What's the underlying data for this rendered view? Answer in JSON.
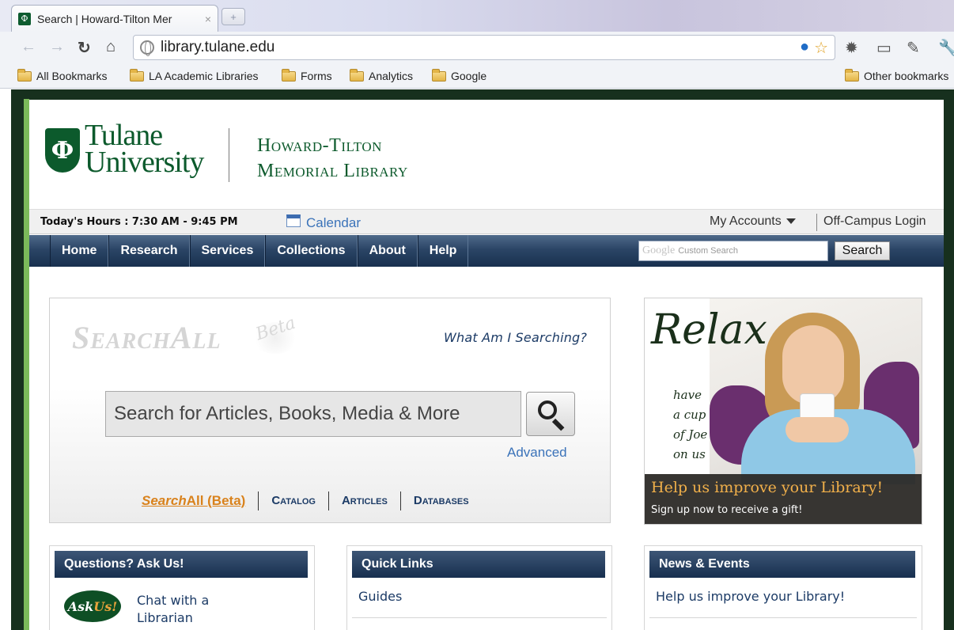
{
  "browser": {
    "tab_title": "Search | Howard-Tilton Mer",
    "url": "library.tulane.edu",
    "bookmarks": [
      "All Bookmarks",
      "LA Academic Libraries",
      "Forms",
      "Analytics",
      "Google"
    ],
    "other_bookmarks": "Other bookmarks"
  },
  "header": {
    "university_line1": "Tulane",
    "university_line2": "University",
    "library_line1": "Howard-Tilton",
    "library_line2": "Memorial Library"
  },
  "infobar": {
    "hours": "Today's Hours : 7:30 AM - 9:45 PM",
    "calendar": "Calendar",
    "my_accounts": "My Accounts",
    "off_campus": "Off-Campus Login"
  },
  "nav": {
    "items": [
      "Home",
      "Research",
      "Services",
      "Collections",
      "About",
      "Help"
    ],
    "search_brand": "Google",
    "search_placeholder": "Custom Search",
    "search_button": "Search"
  },
  "searchall": {
    "logo": "SearchAll",
    "beta": "Beta",
    "what_searching": "What Am I Searching?",
    "input_placeholder": "Search for Articles, Books, Media & More",
    "advanced": "Advanced",
    "tab_first_em": "Search",
    "tab_first_rest": "All (Beta)",
    "tabs": [
      "Catalog",
      "Articles",
      "Databases"
    ]
  },
  "promo": {
    "title": "Relax",
    "sub1": "have",
    "sub2": "a cup",
    "sub3": "of Joe",
    "sub4": "on us",
    "headline": "Help us improve your Library!",
    "subline": "Sign up now to receive a gift!"
  },
  "panels": {
    "questions_title": "Questions? Ask Us!",
    "askus_logo": "Ask",
    "askus_logo_us": "Us!",
    "chat_line1": "Chat with a",
    "chat_line2": "Librarian",
    "quicklinks_title": "Quick Links",
    "quicklinks_first": "Guides",
    "news_title": "News & Events",
    "news_first": "Help us improve your Library!"
  }
}
